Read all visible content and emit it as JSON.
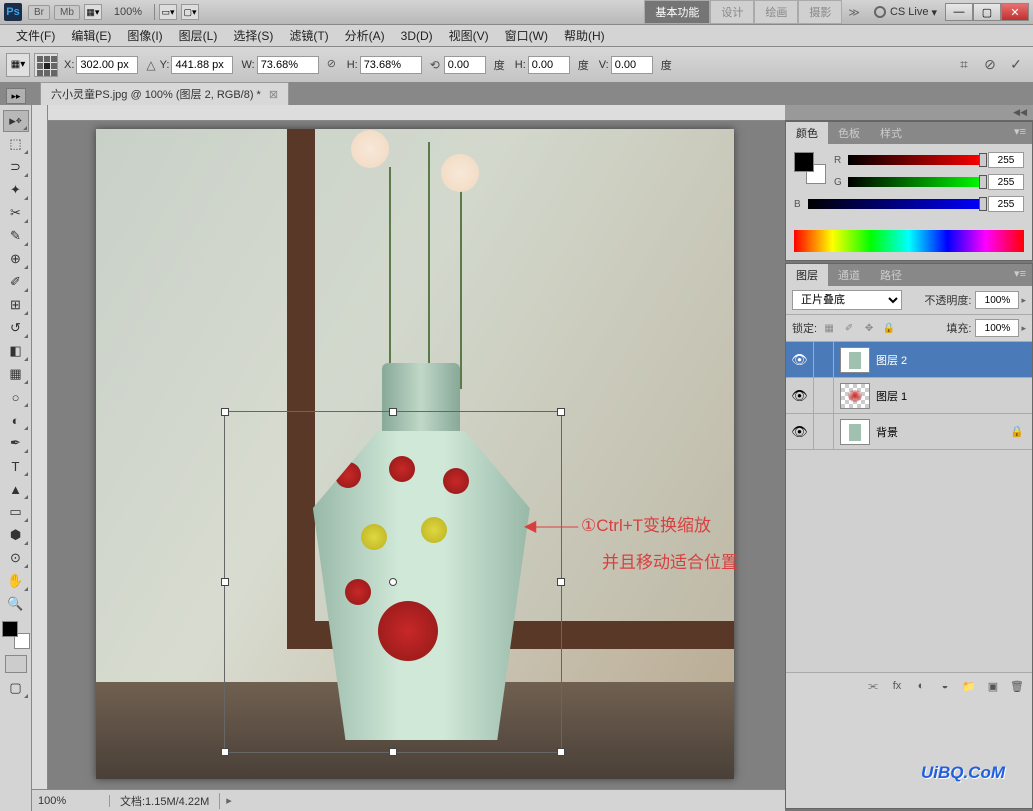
{
  "titlebar": {
    "ps": "Ps",
    "br": "Br",
    "mb": "Mb",
    "zoom": "100%",
    "workspace": {
      "basic": "基本功能",
      "design": "设计",
      "paint": "绘画",
      "photo": "摄影"
    },
    "cslive": "CS Live"
  },
  "menu": {
    "file": "文件(F)",
    "edit": "编辑(E)",
    "image": "图像(I)",
    "layer": "图层(L)",
    "select": "选择(S)",
    "filter": "滤镜(T)",
    "analysis": "分析(A)",
    "threeD": "3D(D)",
    "view": "视图(V)",
    "window": "窗口(W)",
    "help": "帮助(H)"
  },
  "options": {
    "x_label": "X:",
    "x": "302.00 px",
    "y_label": "Y:",
    "y": "441.88 px",
    "w_label": "W:",
    "w": "73.68%",
    "h_label": "H:",
    "h": "73.68%",
    "angle": "0.00",
    "angle_unit": "度",
    "skew_h_label": "H:",
    "skew_h": "0.00",
    "skew_v_label": "V:",
    "skew_v": "0.00"
  },
  "doctab": {
    "title": "六小灵童PS.jpg @ 100% (图层 2, RGB/8) *"
  },
  "annotation": {
    "line1": "①Ctrl+T变换缩放",
    "line2": "并且移动适合位置"
  },
  "statusbar": {
    "zoom": "100%",
    "info": "文档:1.15M/4.22M"
  },
  "panels": {
    "color_tabs": {
      "color": "颜色",
      "swatches": "色板",
      "styles": "样式"
    },
    "rgb": {
      "r": "255",
      "g": "255",
      "b": "255",
      "r_label": "R",
      "g_label": "G",
      "b_label": "B"
    },
    "layer_tabs": {
      "layers": "图层",
      "channels": "通道",
      "paths": "路径"
    },
    "blend_mode": "正片叠底",
    "opacity_label": "不透明度:",
    "opacity": "100%",
    "lock_label": "锁定:",
    "fill_label": "填充:",
    "fill": "100%",
    "layers": [
      {
        "name": "图层 2",
        "selected": true,
        "checker": false
      },
      {
        "name": "图层 1",
        "selected": false,
        "checker": true
      },
      {
        "name": "背景",
        "selected": false,
        "checker": false,
        "locked": true
      }
    ]
  },
  "watermark": "UiBQ.CoM"
}
